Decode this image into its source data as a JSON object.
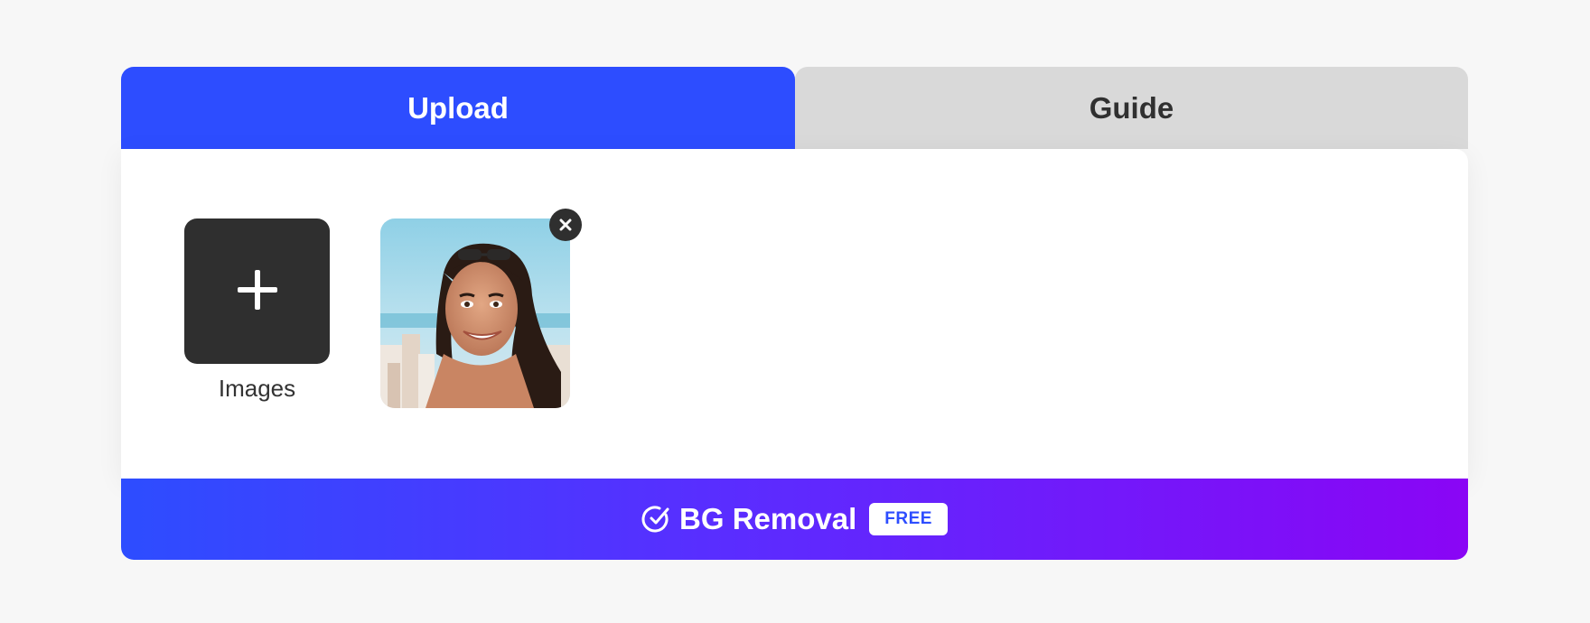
{
  "tabs": {
    "upload_label": "Upload",
    "guide_label": "Guide",
    "active": "Upload"
  },
  "uploader": {
    "add_label": "Images",
    "add_icon": "plus-icon",
    "remove_icon": "close-icon"
  },
  "footer": {
    "action_label": "BG Removal",
    "badge": "FREE",
    "icon": "check-circle-icon"
  },
  "colors": {
    "accent": "#2d4dff",
    "gradient_end": "#8a05f5",
    "inactive_tab": "#d9d9d9",
    "tile_dark": "#2f2f2f"
  }
}
